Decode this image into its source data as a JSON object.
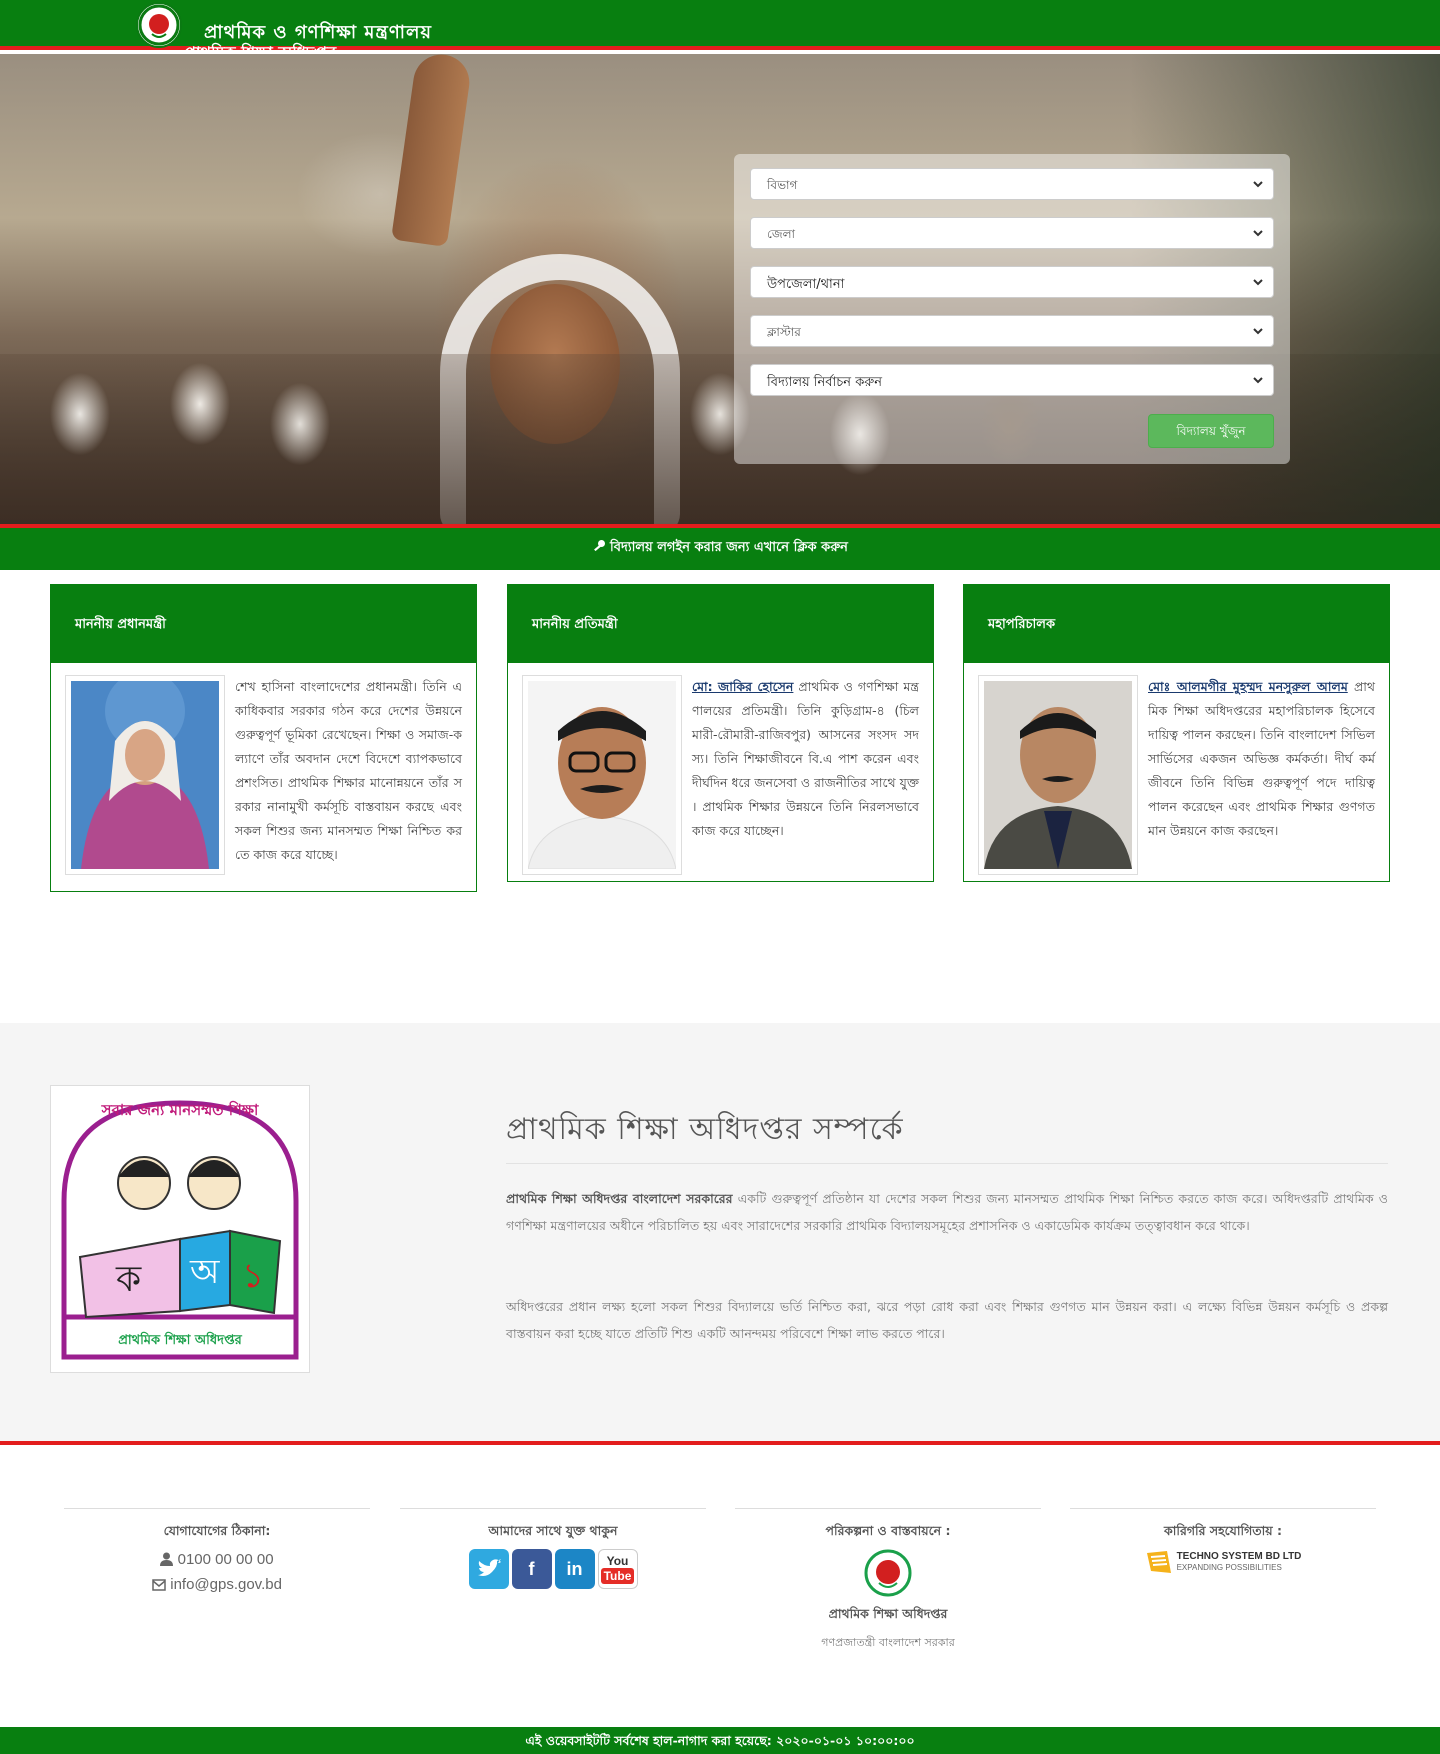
{
  "header": {
    "title_line1": "প্রাথমিক ও গণশিক্ষা মন্ত্রণালয়",
    "title_line2": "প্রাথমিক শিক্ষা অধিদপ্তর"
  },
  "search": {
    "division_placeholder": "বিভাগ",
    "district_placeholder": "জেলা",
    "upazila_placeholder": "উপজেলা/থানা",
    "cluster_placeholder": "ক্লাস্টার",
    "school_placeholder": "বিদ্যালয় নির্বাচন করুন",
    "submit_label": "বিদ্যালয় খুঁজুন"
  },
  "login_bar": {
    "label": "বিদ্যালয় লগইন করার জন্য এখানে ক্লিক করুন"
  },
  "cards": [
    {
      "heading": "মাননীয় প্রধানমন্ত্রী",
      "name": "",
      "text": "শেখ হাসিনা বাংলাদেশের প্রধানমন্ত্রী। তিনি একাধিকবার সরকার গঠন করে দেশের উন্নয়নে গুরুত্বপূর্ণ ভূমিকা রেখেছেন। শিক্ষা ও সমাজ-কল্যাণে তাঁর অবদান দেশে বিদেশে ব্যাপকভাবে প্রশংসিত। প্রাথমিক শিক্ষার মানোন্নয়নে তাঁর সরকার নানামুখী কর্মসূচি বাস্তবায়ন করছে এবং সকল শিশুর জন্য মানসম্মত শিক্ষা নিশ্চিত করতে কাজ করে যাচ্ছে।"
    },
    {
      "heading": "মাননীয় প্রতিমন্ত্রী",
      "name": "মো: জাকির হোসেন",
      "text": " প্রাথমিক ও গণশিক্ষা মন্ত্রণালয়ের প্রতিমন্ত্রী। তিনি কুড়িগ্রাম-৪ (চিলমারী-রৌমারী-রাজিবপুর) আসনের সংসদ সদস্য। তিনি শিক্ষাজীবনে বি.এ পাশ করেন এবং দীর্ঘদিন ধরে জনসেবা ও রাজনীতির সাথে যুক্ত। প্রাথমিক শিক্ষার উন্নয়নে তিনি নিরলসভাবে কাজ করে যাচ্ছেন।"
    },
    {
      "heading": "মহাপরিচালক",
      "name": "মোঃ আলমগীর মুহম্মদ মনসুরুল আলম",
      "text": " প্রাথমিক শিক্ষা অধিদপ্তরের মহাপরিচালক হিসেবে দায়িত্ব পালন করছেন। তিনি বাংলাদেশ সিভিল সার্ভিসের একজন অভিজ্ঞ কর্মকর্তা। দীর্ঘ কর্মজীবনে তিনি বিভিন্ন গুরুত্বপূর্ণ পদে দায়িত্ব পালন করেছেন এবং প্রাথমিক শিক্ষার গুণগত মান উন্নয়নে কাজ করছেন।"
    }
  ],
  "about": {
    "heading": "প্রাথমিক শিক্ষা অধিদপ্তর সম্পর্কে",
    "logo_top_text": "সবার জন্য মানসম্মত শিক্ষা",
    "logo_bottom_text": "প্রাথমিক শিক্ষা অধিদপ্তর",
    "p1_lead": "প্রাথমিক শিক্ষা অধিদপ্তর বাংলাদেশ সরকারের",
    "p1_rest": " একটি গুরুত্বপূর্ণ প্রতিষ্ঠান যা দেশের সকল শিশুর জন্য মানসম্মত প্রাথমিক শিক্ষা নিশ্চিত করতে কাজ করে। অধিদপ্তরটি প্রাথমিক ও গণশিক্ষা মন্ত্রণালয়ের অধীনে পরিচালিত হয় এবং সারাদেশের সরকারি প্রাথমিক বিদ্যালয়সমূহের প্রশাসনিক ও একাডেমিক কার্যক্রম তত্ত্বাবধান করে থাকে।",
    "p2": "অধিদপ্তরের প্রধান লক্ষ্য হলো সকল শিশুর বিদ্যালয়ে ভর্তি নিশ্চিত করা, ঝরে পড়া রোধ করা এবং শিক্ষার গুণগত মান উন্নয়ন করা। এ লক্ষ্যে বিভিন্ন উন্নয়ন কর্মসূচি ও প্রকল্প বাস্তবায়ন করা হচ্ছে যাতে প্রতিটি শিশু একটি আনন্দময় পরিবেশে শিক্ষা লাভ করতে পারে।"
  },
  "footer": {
    "contact_heading": "যোগাযোগের ঠিকানা:",
    "phone": "0100 00 00 00",
    "email": "info@gps.gov.bd",
    "social_heading": "আমাদের সাথে যুক্ত থাকুন",
    "planning_heading": "পরিকল্পনা ও বাস্তবায়নে :",
    "planning_org": "প্রাথমিক শিক্ষা অধিদপ্তর",
    "planning_sub": "গণপ্রজাতন্ত্রী বাংলাদেশ সরকার",
    "tech_heading": "কারিগরি সহযোগিতায় :",
    "tech_company": "TECHNO SYSTEM BD LTD",
    "tech_tagline": "EXPANDING POSSIBILITIES",
    "bottom_text": "এই ওয়েবসাইটটি সর্বশেষ হাল-নাগাদ করা হয়েছে: ২০২০-০১-০১ ১০:০০:০০"
  },
  "colors": {
    "brand_green": "#087f10",
    "accent_red": "#e31d1d",
    "button_green": "#5cb85c"
  }
}
